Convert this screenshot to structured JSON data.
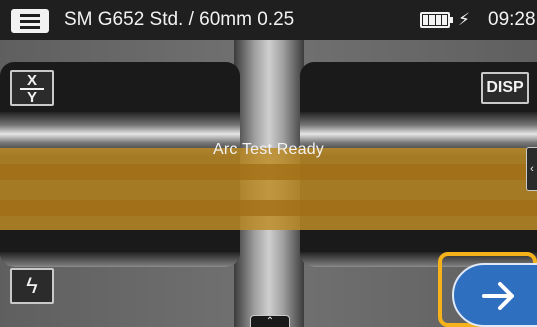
{
  "status_bar": {
    "menu_icon": "hamburger-menu-icon",
    "title": "SM G652 Std. / 60mm 0.25",
    "battery_icon": "battery-full-icon",
    "charge_icon": "lightning-icon",
    "time": "09:28"
  },
  "buttons": {
    "xy_top": "X",
    "xy_bottom": "Y",
    "disp_label": "DISP",
    "flash_icon": "lightning-bolt-icon",
    "side_tab_icon": "chevron-left-icon",
    "bottom_tab_icon": "chevron-up-icon",
    "next_icon": "arrow-right-icon"
  },
  "main": {
    "status_message": "Arc Test Ready"
  },
  "colors": {
    "highlight": "#f5b21a",
    "next_button": "#2f6fc0",
    "status_bar": "#1f1f1f",
    "arc_band": "#be8c28"
  }
}
